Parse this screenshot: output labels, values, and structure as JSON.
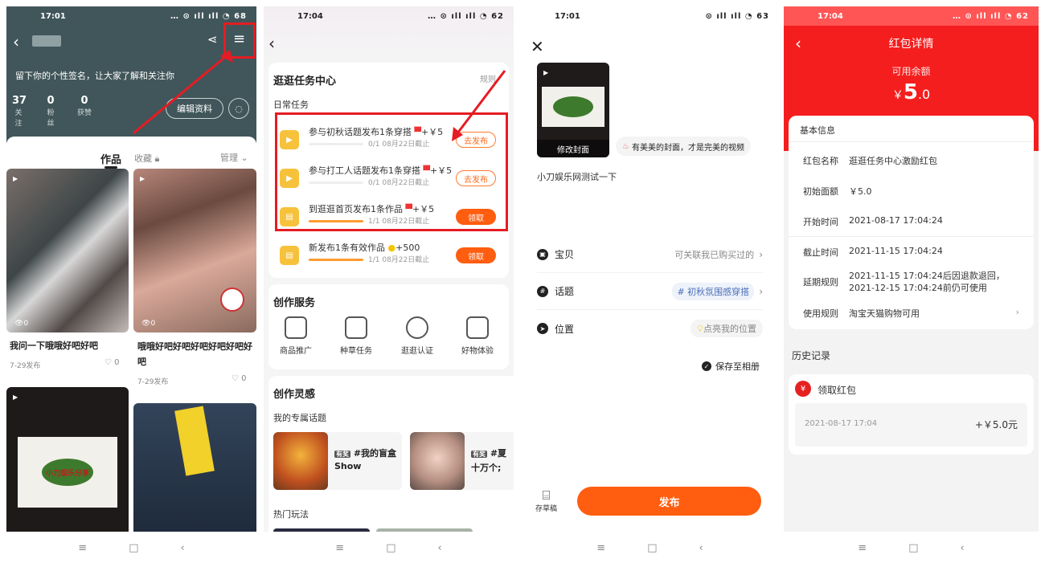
{
  "colors": {
    "teal_header": "#41565a",
    "orange": "#ff5d0f",
    "red": "#f51e1e",
    "highlight": "#e51c23"
  },
  "p1": {
    "time": "17:01",
    "battery": "68",
    "signature": "留下你的个性签名，让大家了解和关注你",
    "stats": [
      {
        "num": "37",
        "label": "关注"
      },
      {
        "num": "0",
        "label": "粉丝"
      },
      {
        "num": "0",
        "label": "获赞"
      }
    ],
    "edit_label": "编辑资料",
    "tabs": {
      "works": "作品",
      "collect": "收藏",
      "manage": "管理"
    },
    "posts": [
      {
        "views": "0",
        "title": "我问一下哦哦好吧好吧",
        "date": "7-29发布",
        "likes": "0"
      },
      {
        "views": "0",
        "title": "哦哦好吧好吧好吧好吧好吧好吧",
        "date": "7-29发布",
        "likes": "0"
      }
    ],
    "post3_logo": "小刀娱乐分享"
  },
  "p2": {
    "time": "17:04",
    "battery": "62",
    "task_center": {
      "title": "逛逛任务中心",
      "rule": "规则",
      "daily": "日常任务"
    },
    "tasks": [
      {
        "title": "参与初秋话题发布1条穿搭",
        "reward": "+￥5",
        "progress": "0/1",
        "deadline": "08月22日截止",
        "action": "去发布",
        "ratio": 0
      },
      {
        "title": "参与打工人话题发布1条穿搭",
        "reward": "+￥5",
        "progress": "0/1",
        "deadline": "08月22日截止",
        "action": "去发布",
        "ratio": 0
      },
      {
        "title": "到逛逛首页发布1条作品",
        "reward": "+￥5",
        "progress": "1/1",
        "deadline": "08月22日截止",
        "action": "领取",
        "ratio": 1
      },
      {
        "title": "新发布1条有效作品",
        "reward": "+500",
        "progress": "1/1",
        "deadline": "08月22日截止",
        "action": "领取",
        "ratio": 1
      }
    ],
    "services": {
      "title": "创作服务",
      "items": [
        "商品推广",
        "种草任务",
        "逛逛认证",
        "好物体验"
      ]
    },
    "inspiration": {
      "title": "创作灵感",
      "sub": "我的专属话题",
      "badge": "有奖",
      "topic1": "#我的盲盒",
      "topic1b": "Show",
      "topic2": "#夏",
      "topic2b": "十万个;",
      "hot": "热门玩法"
    }
  },
  "p3": {
    "time": "17:01",
    "battery": "63",
    "edit_cover": "修改封面",
    "cover_tip": "有美美的封面，才是完美的视频",
    "description": "小刀娱乐网测试一下",
    "rows": [
      {
        "label": "宝贝",
        "value": "可关联我已购买过的"
      },
      {
        "label": "话题",
        "value": "# 初秋氛围感穿搭"
      },
      {
        "label": "位置",
        "value": "点亮我的位置"
      }
    ],
    "save_album": "保存至相册",
    "draft": "存草稿",
    "publish": "发布"
  },
  "p4": {
    "time": "17:04",
    "battery": "62",
    "title": "红包详情",
    "balance_label": "可用余额",
    "currency": "￥",
    "balance_int": "5",
    "balance_dec": ".0",
    "basic": "基本信息",
    "info": [
      {
        "k": "红包名称",
        "v": "逛逛任务中心激励红包"
      },
      {
        "k": "初始面额",
        "v": "￥5.0"
      },
      {
        "k": "开始时间",
        "v": "2021-08-17 17:04:24"
      },
      {
        "k": "截止时间",
        "v": "2021-11-15 17:04:24"
      },
      {
        "k": "延期规则",
        "v": "2021-11-15 17:04:24后因退款退回，",
        "v2": "2021-12-15 17:04:24前仍可使用"
      },
      {
        "k": "使用规则",
        "v": "淘宝天猫购物可用"
      }
    ],
    "history": "历史记录",
    "record": {
      "title": "领取红包",
      "time": "2021-08-17 17:04",
      "amount": "+￥5.0元"
    }
  },
  "nav": [
    "≡",
    "□",
    "‹"
  ]
}
